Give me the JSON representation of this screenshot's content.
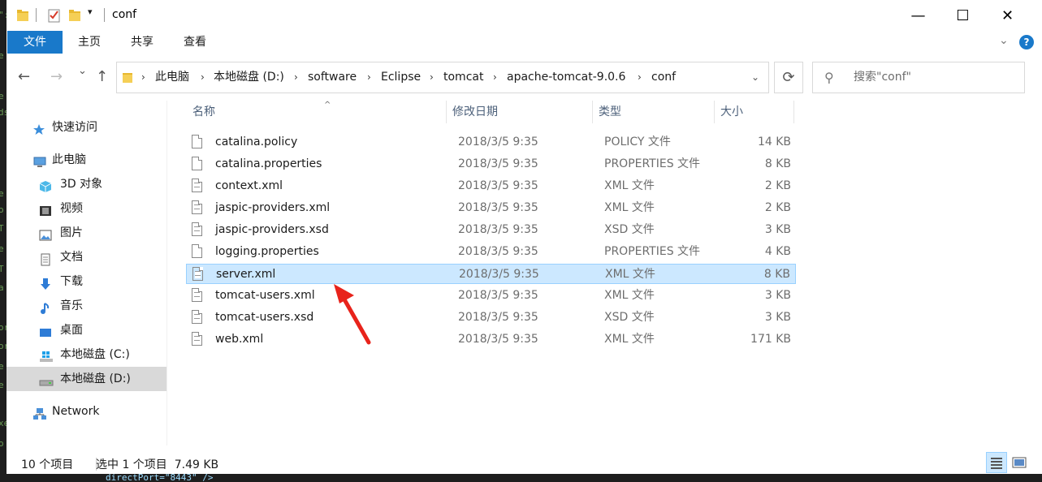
{
  "window": {
    "title": "conf",
    "controls": {
      "minimize": "—",
      "maximize": "☐",
      "close": "✕"
    }
  },
  "ribbon": {
    "tabs": [
      "文件",
      "主页",
      "共享",
      "查看"
    ],
    "expand_icon": "chevron-down-icon",
    "help": "?"
  },
  "navigation": {
    "back": "←",
    "forward": "→",
    "recent": "⌄",
    "up": "↑",
    "breadcrumbs": [
      "此电脑",
      "本地磁盘 (D:)",
      "software",
      "Eclipse",
      "tomcat",
      "apache-tomcat-9.0.6",
      "conf"
    ],
    "separator": "›",
    "refresh": "⟳",
    "search_placeholder": "搜索\"conf\""
  },
  "sidebar": {
    "items": [
      {
        "label": "快速访问",
        "icon": "star-icon",
        "indent": 0
      },
      {
        "label": "此电脑",
        "icon": "computer-icon",
        "indent": 0
      },
      {
        "label": "3D 对象",
        "icon": "cube-icon",
        "indent": 1
      },
      {
        "label": "视频",
        "icon": "video-icon",
        "indent": 1
      },
      {
        "label": "图片",
        "icon": "picture-icon",
        "indent": 1
      },
      {
        "label": "文档",
        "icon": "document-icon",
        "indent": 1
      },
      {
        "label": "下载",
        "icon": "download-icon",
        "indent": 1
      },
      {
        "label": "音乐",
        "icon": "music-icon",
        "indent": 1
      },
      {
        "label": "桌面",
        "icon": "desktop-icon",
        "indent": 1
      },
      {
        "label": "本地磁盘 (C:)",
        "icon": "windows-drive-icon",
        "indent": 1
      },
      {
        "label": "本地磁盘 (D:)",
        "icon": "drive-icon",
        "indent": 1,
        "selected": true
      },
      {
        "label": "Network",
        "icon": "network-icon",
        "indent": 0
      }
    ]
  },
  "file_list": {
    "columns": [
      "名称",
      "修改日期",
      "类型",
      "大小"
    ],
    "sort_indicator": "^",
    "rows": [
      {
        "name": "catalina.policy",
        "date": "2018/3/5 9:35",
        "type": "POLICY 文件",
        "size": "14 KB"
      },
      {
        "name": "catalina.properties",
        "date": "2018/3/5 9:35",
        "type": "PROPERTIES 文件",
        "size": "8 KB"
      },
      {
        "name": "context.xml",
        "date": "2018/3/5 9:35",
        "type": "XML 文件",
        "size": "2 KB"
      },
      {
        "name": "jaspic-providers.xml",
        "date": "2018/3/5 9:35",
        "type": "XML 文件",
        "size": "2 KB"
      },
      {
        "name": "jaspic-providers.xsd",
        "date": "2018/3/5 9:35",
        "type": "XSD 文件",
        "size": "3 KB"
      },
      {
        "name": "logging.properties",
        "date": "2018/3/5 9:35",
        "type": "PROPERTIES 文件",
        "size": "4 KB"
      },
      {
        "name": "server.xml",
        "date": "2018/3/5 9:35",
        "type": "XML 文件",
        "size": "8 KB",
        "selected": true
      },
      {
        "name": "tomcat-users.xml",
        "date": "2018/3/5 9:35",
        "type": "XML 文件",
        "size": "3 KB"
      },
      {
        "name": "tomcat-users.xsd",
        "date": "2018/3/5 9:35",
        "type": "XSD 文件",
        "size": "3 KB"
      },
      {
        "name": "web.xml",
        "date": "2018/3/5 9:35",
        "type": "XML 文件",
        "size": "171 KB"
      }
    ]
  },
  "status": {
    "item_count": "10 个项目",
    "selection": "选中 1 个项目  7.49 KB"
  },
  "colors": {
    "accent": "#1979ca",
    "selection": "#cce8ff",
    "annotation_arrow": "#e8231b"
  }
}
